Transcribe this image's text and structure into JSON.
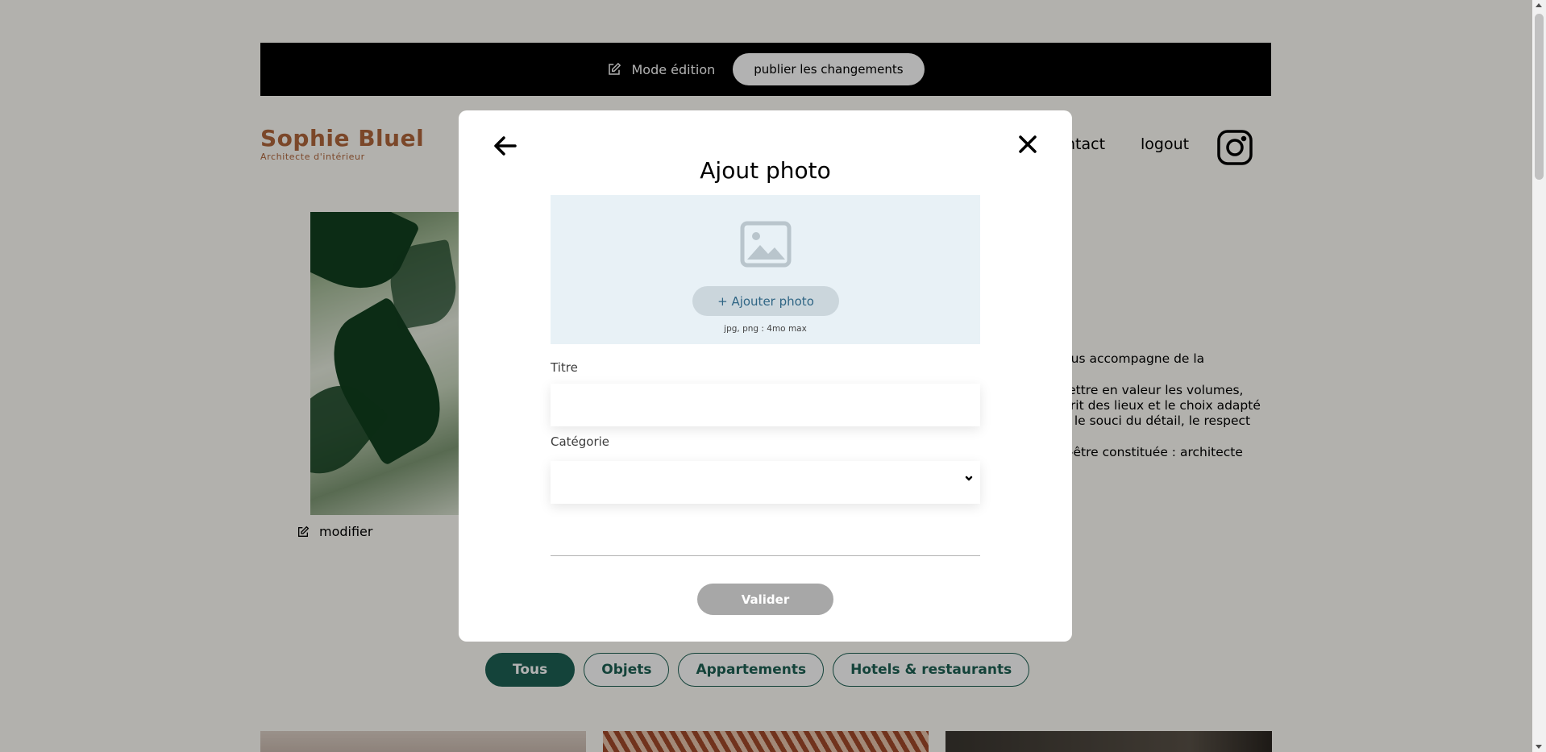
{
  "edit_bar": {
    "mode_label": "Mode édition",
    "publish_label": "publier les changements"
  },
  "header": {
    "logo_name": "Sophie Bluel",
    "logo_subtitle": "Architecte d'intérieur",
    "nav": [
      "ntact",
      "logout"
    ],
    "instagram_icon": "instagram-icon"
  },
  "intro": {
    "modify_label": "modifier",
    "paragraphs": [
      "vous accompagne de la",
      "mettre en valeur les volumes, sprit des lieux et le choix adapté ns le souci du détail, le respect",
      "ut-être constituée : architecte"
    ]
  },
  "filters": [
    "Tous",
    "Objets",
    "Appartements",
    "Hotels & restaurants"
  ],
  "modal": {
    "title": "Ajout photo",
    "back_icon": "arrow-left-icon",
    "close_icon": "close-icon",
    "upload": {
      "icon": "image-placeholder-icon",
      "button_label": "+ Ajouter photo",
      "hint": "jpg, png : 4mo max"
    },
    "title_field": {
      "label": "Titre",
      "value": ""
    },
    "category_field": {
      "label": "Catégorie",
      "selected": ""
    },
    "submit_label": "Valider"
  },
  "colors": {
    "accent_green": "#1d6154",
    "brand": "#b1663c",
    "upload_bg": "#e8f1f6",
    "submit_disabled": "#a7a7a7"
  }
}
